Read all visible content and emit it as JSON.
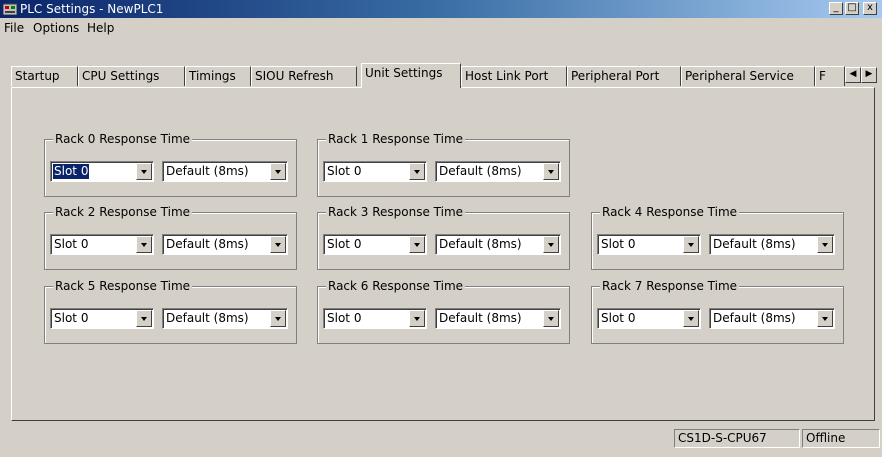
{
  "window": {
    "title": "PLC Settings - NewPLC1",
    "minimize": "_",
    "maximize": "□",
    "close": "x"
  },
  "menu": [
    {
      "label": "File"
    },
    {
      "label": "Options"
    },
    {
      "label": "Help"
    }
  ],
  "tabs": [
    {
      "label": "Startup",
      "active": false
    },
    {
      "label": "CPU Settings",
      "active": false
    },
    {
      "label": "Timings",
      "active": false
    },
    {
      "label": "SIOU Refresh",
      "active": false
    },
    {
      "label": "Unit Settings",
      "active": true
    },
    {
      "label": "Host Link Port",
      "active": false
    },
    {
      "label": "Peripheral Port",
      "active": false
    },
    {
      "label": "Peripheral Service",
      "active": false
    },
    {
      "label": "F",
      "active": false
    }
  ],
  "tab_scroll": {
    "left": "◀",
    "right": "▶"
  },
  "groups": [
    {
      "label": "Rack 0 Response Time",
      "slot": "Slot 0",
      "time": "Default (8ms)"
    },
    {
      "label": "Rack 1 Response Time",
      "slot": "Slot 0",
      "time": "Default (8ms)"
    },
    {
      "label": "Rack 2 Response Time",
      "slot": "Slot 0",
      "time": "Default (8ms)"
    },
    {
      "label": "Rack 3 Response Time",
      "slot": "Slot 0",
      "time": "Default (8ms)"
    },
    {
      "label": "Rack 4 Response Time",
      "slot": "Slot 0",
      "time": "Default (8ms)"
    },
    {
      "label": "Rack 5 Response Time",
      "slot": "Slot 0",
      "time": "Default (8ms)"
    },
    {
      "label": "Rack 6 Response Time",
      "slot": "Slot 0",
      "time": "Default (8ms)"
    },
    {
      "label": "Rack 7 Response Time",
      "slot": "Slot 0",
      "time": "Default (8ms)"
    }
  ],
  "status": {
    "model": "CS1D-S-CPU67",
    "connection": "Offline"
  },
  "colors": {
    "titlebar_start": "#0a246a",
    "titlebar_end": "#a6caf0",
    "face": "#d4d0c8",
    "selection": "#0a246a"
  }
}
